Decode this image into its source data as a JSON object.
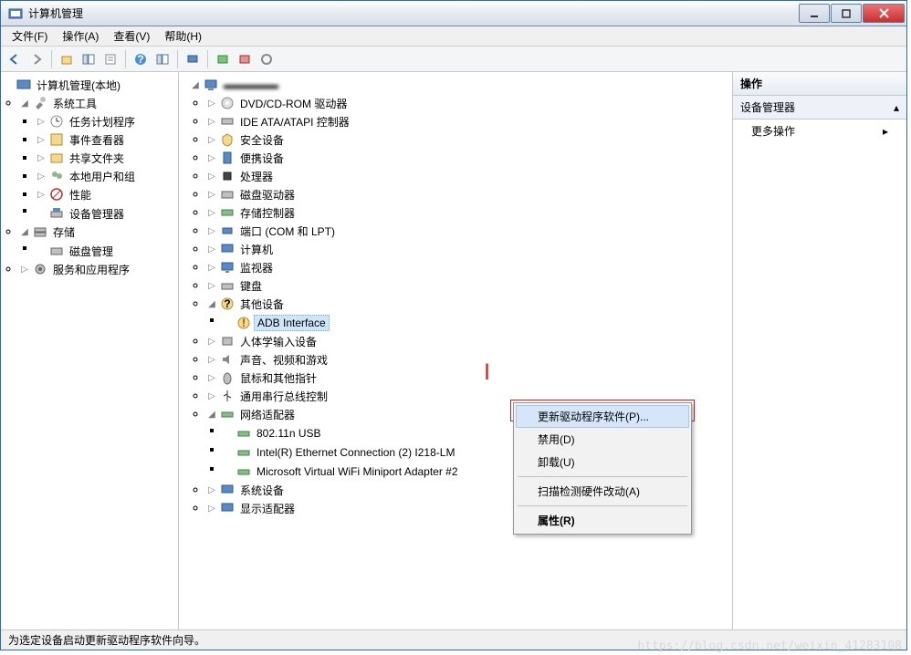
{
  "window": {
    "title": "计算机管理"
  },
  "menubar": [
    "文件(F)",
    "操作(A)",
    "查看(V)",
    "帮助(H)"
  ],
  "left_tree": {
    "root": "计算机管理(本地)",
    "sys_tools": "系统工具",
    "task_sched": "任务计划程序",
    "event_viewer": "事件查看器",
    "shared_folders": "共享文件夹",
    "local_users": "本地用户和组",
    "performance": "性能",
    "device_mgr": "设备管理器",
    "storage": "存储",
    "disk_mgmt": "磁盘管理",
    "services": "服务和应用程序"
  },
  "mid_tree": {
    "root": "▬▬▬▬▬",
    "dvd": "DVD/CD-ROM 驱动器",
    "ide": "IDE ATA/ATAPI 控制器",
    "security": "安全设备",
    "portable": "便携设备",
    "processor": "处理器",
    "disk_drives": "磁盘驱动器",
    "storage_ctrl": "存储控制器",
    "ports": "端口 (COM 和 LPT)",
    "computer": "计算机",
    "monitor": "监视器",
    "keyboard": "键盘",
    "other": "其他设备",
    "adb": "ADB Interface",
    "hid": "人体学输入设备",
    "sound": "声音、视频和游戏",
    "mouse": "鼠标和其他指针",
    "usb": "通用串行总线控制",
    "net": "网络适配器",
    "net1": "802.11n USB",
    "net2": "Intel(R) Ethernet Connection (2) I218-LM",
    "net3": "Microsoft Virtual WiFi Miniport Adapter #2",
    "system": "系统设备",
    "display": "显示适配器"
  },
  "context_menu": {
    "update": "更新驱动程序软件(P)...",
    "disable": "禁用(D)",
    "uninstall": "卸载(U)",
    "scan": "扫描检测硬件改动(A)",
    "properties": "属性(R)"
  },
  "right_pane": {
    "header": "操作",
    "section": "设备管理器",
    "more": "更多操作"
  },
  "statusbar": "为选定设备启动更新驱动程序软件向导。",
  "watermark": "https://blog.csdn.net/weixin_41283108"
}
